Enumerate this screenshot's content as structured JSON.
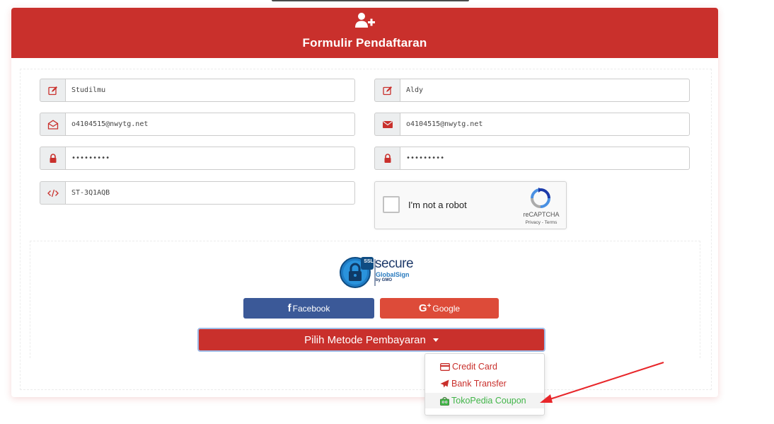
{
  "header": {
    "title": "Formulir Pendaftaran",
    "icon": "user-plus-icon"
  },
  "fields": {
    "username": "Studilmu",
    "name": "Aldy",
    "email": "o4104515@nwytg.net",
    "email_confirm": "o4104515@nwytg.net",
    "password": "•••••••••",
    "password_confirm": "•••••••••",
    "referral_code": "ST-3Q1AQB"
  },
  "captcha": {
    "label": "I'm not a robot",
    "brand": "reCAPTCHA",
    "terms": "Privacy - Terms"
  },
  "ssl_seal": {
    "badge": "SSL",
    "word": "secure",
    "brand": "GlobalSign",
    "sub": "by GMO"
  },
  "social": {
    "facebook_label": "Facebook",
    "google_label": "Google"
  },
  "payment": {
    "button_label": "Pilih Metode Pembayaran",
    "options": [
      "Credit Card",
      "Bank Transfer",
      "TokoPedia Coupon"
    ]
  },
  "colors": {
    "primary": "#c9302c",
    "facebook": "#3b5998",
    "google": "#dd4b39",
    "tokopedia": "#42b549",
    "annotation_arrow": "#e8262a"
  }
}
